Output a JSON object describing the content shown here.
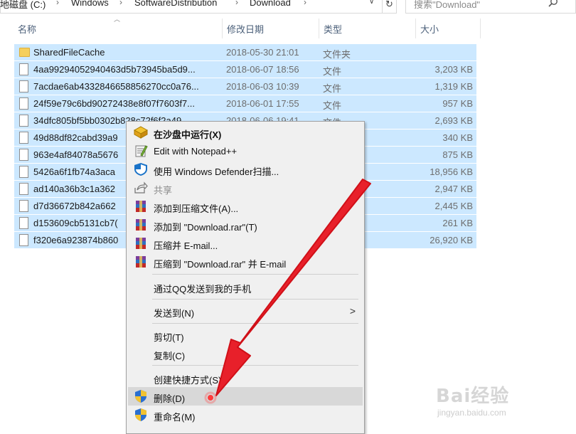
{
  "addressbar": {
    "crumbs": [
      "本地磁盘 (C:)",
      "Windows",
      "SoftwareDistribution",
      "Download"
    ]
  },
  "search": {
    "placeholder": "搜索\"Download\""
  },
  "columns": {
    "name": "名称",
    "date": "修改日期",
    "type": "类型",
    "size": "大小"
  },
  "rows": [
    {
      "name": "SharedFileCache",
      "date": "2018-05-30 21:01",
      "type": "文件夹",
      "size": "",
      "kind": "folder"
    },
    {
      "name": "4aa99294052940463d5b73945ba5d9...",
      "date": "2018-06-07 18:56",
      "type": "文件",
      "size": "3,203 KB",
      "kind": "file"
    },
    {
      "name": "7acdae6ab4332846658856270cc0a76...",
      "date": "2018-06-03 10:39",
      "type": "文件",
      "size": "1,319 KB",
      "kind": "file"
    },
    {
      "name": "24f59e79c6bd90272438e8f07f7603f7...",
      "date": "2018-06-01 17:55",
      "type": "文件",
      "size": "957 KB",
      "kind": "file"
    },
    {
      "name": "34dfc805bf5bb0302b828c72f6f2a49...",
      "date": "2018-06-06 19:41",
      "type": "文件",
      "size": "2,693 KB",
      "kind": "file"
    },
    {
      "name": "49d88df82cabd39a9",
      "date": "",
      "type": "",
      "size": "340 KB",
      "kind": "file"
    },
    {
      "name": "963e4af84078a5676",
      "date": "",
      "type": "",
      "size": "875 KB",
      "kind": "file"
    },
    {
      "name": "5426a6f1fb74a3aca",
      "date": "",
      "type": "",
      "size": "18,956 KB",
      "kind": "file"
    },
    {
      "name": "ad140a36b3c1a362",
      "date": "",
      "type": "",
      "size": "2,947 KB",
      "kind": "file"
    },
    {
      "name": "d7d36672b842a662",
      "date": "",
      "type": "",
      "size": "2,445 KB",
      "kind": "file"
    },
    {
      "name": "d153609cb5131cb7(",
      "date": "",
      "type": "",
      "size": "261 KB",
      "kind": "file"
    },
    {
      "name": "f320e6a923874b860",
      "date": "",
      "type": "",
      "size": "26,920 KB",
      "kind": "file"
    }
  ],
  "context_menu": {
    "items": [
      {
        "label": "在沙盘中运行(X)",
        "icon": "sandbox-icon",
        "bold": true
      },
      {
        "label": "Edit with Notepad++",
        "icon": "notepad-plus-icon"
      },
      {
        "label": "使用 Windows Defender扫描...",
        "icon": "defender-shield-icon"
      },
      {
        "label": "共享",
        "icon": "share-icon",
        "disabled": true
      },
      {
        "label": "添加到压缩文件(A)...",
        "icon": "winrar-icon"
      },
      {
        "label": "添加到 \"Download.rar\"(T)",
        "icon": "winrar-icon"
      },
      {
        "label": "压缩并 E-mail...",
        "icon": "winrar-icon"
      },
      {
        "label": "压缩到 \"Download.rar\" 并 E-mail",
        "icon": "winrar-icon"
      },
      {
        "label": "通过QQ发送到我的手机",
        "icon": ""
      },
      {
        "label": "发送到(N)",
        "icon": "",
        "submenu": true
      },
      {
        "label": "剪切(T)",
        "icon": ""
      },
      {
        "label": "复制(C)",
        "icon": ""
      },
      {
        "label": "创建快捷方式(S)",
        "icon": ""
      },
      {
        "label": "删除(D)",
        "icon": "uac-shield-icon",
        "highlighted": true
      },
      {
        "label": "重命名(M)",
        "icon": "uac-shield-icon"
      }
    ]
  },
  "watermark": {
    "main": "Bai经验",
    "sub": "jingyan.baidu.com"
  },
  "colors": {
    "selection": "#cce8ff",
    "arrow": "#e8202a",
    "menu_bg": "#f0f0f0",
    "highlight": "#d8d8d8"
  }
}
